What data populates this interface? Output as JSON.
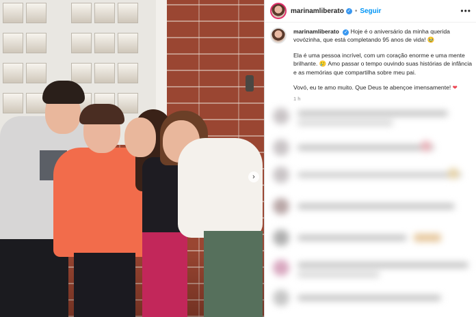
{
  "post": {
    "username": "marinamliberato",
    "verified_mark": "✓",
    "separator": "•",
    "follow_label": "Seguir",
    "more_icon": "more-dots-icon",
    "caption_line1": "Hoje é o aniversário da minha querida vovózinha, que está completando 95 anos de vida!",
    "caption_emoji1": "🥹",
    "caption_line2a": "Ela é uma pessoa incrível, com um coração enorme e uma mente brilhante.",
    "caption_emoji2": "🥲",
    "caption_line2b": "Amo passar o tempo ouvindo suas histórias de infância e as memórias que compartilha sobre meu pai.",
    "caption_line3": "Vovó, eu te amo muito. Que Deus te abençoe imensamente!",
    "caption_heart": "❤",
    "timestamp": "1 h"
  },
  "photo": {
    "next_arrow": "›"
  },
  "colors": {
    "link_blue": "#0095f6",
    "verified_blue": "#3897f0",
    "heart_red": "#ed4956",
    "text_dark": "#262626",
    "text_muted": "#8e8e8e"
  }
}
